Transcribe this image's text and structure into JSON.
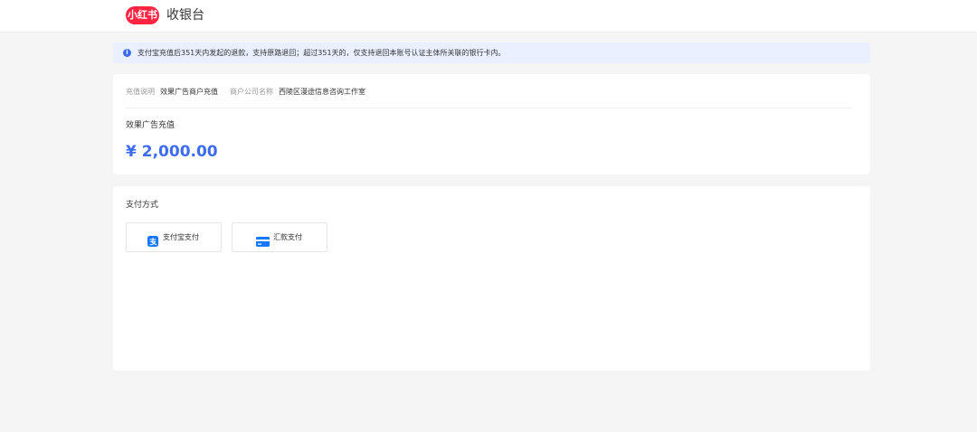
{
  "header": {
    "logo_text": "小红书",
    "title": "收银台",
    "brand_color": "#ff2442"
  },
  "notice": {
    "icon": "info-icon",
    "text": "支付宝充值后351天内发起的退款，支持原路退回；超过351天的，仅支持退回本账号认证主体所关联的银行卡内。"
  },
  "order": {
    "recharge_label": "充值说明",
    "recharge_value": "效果广告商户充值",
    "merchant_label": "商户公司名称",
    "merchant_value": "西陵区漫途信息咨询工作室",
    "product_name": "效果广告充值",
    "amount": "¥ 2,000.00",
    "amount_color": "#3d6cf0"
  },
  "payment": {
    "section_title": "支付方式",
    "methods": [
      {
        "label": "支付宝支付",
        "icon": "alipay-icon"
      },
      {
        "label": "汇款支付",
        "icon": "bank-card-icon"
      }
    ]
  }
}
